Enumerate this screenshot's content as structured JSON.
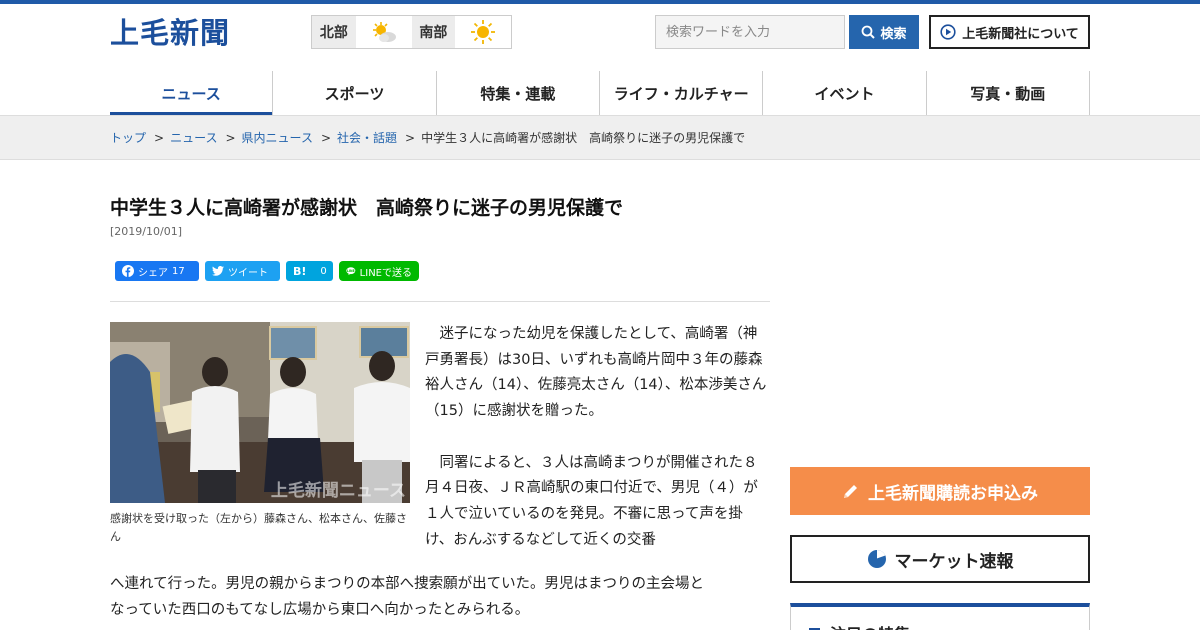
{
  "header": {
    "logo": "上毛新聞",
    "weather": [
      {
        "region": "北部",
        "icon": "partly-sunny-icon"
      },
      {
        "region": "南部",
        "icon": "sunny-icon"
      }
    ],
    "search": {
      "placeholder": "検索ワードを入力",
      "button_label": "検索"
    },
    "about_label": "上毛新聞社について"
  },
  "nav": {
    "items": [
      {
        "label": "ニュース",
        "active": true
      },
      {
        "label": "スポーツ"
      },
      {
        "label": "特集・連載"
      },
      {
        "label": "ライフ・カルチャー"
      },
      {
        "label": "イベント"
      },
      {
        "label": "写真・動画"
      }
    ]
  },
  "breadcrumb": {
    "items": [
      "トップ",
      "ニュース",
      "県内ニュース",
      "社会・話題"
    ],
    "current": "中学生３人に高崎署が感謝状　高崎祭りに迷子の男児保護で",
    "separator": ">"
  },
  "article": {
    "title": "中学生３人に高崎署が感謝状　高崎祭りに迷子の男児保護で",
    "date": "[2019/10/01]",
    "share": {
      "facebook_label": "シェア",
      "facebook_count": "17",
      "twitter_label": "ツイート",
      "hatena_label": "B!",
      "hatena_count": "0",
      "line_label": "LINEで送る"
    },
    "photo_watermark": "上毛新聞ニュース",
    "photo_caption": "感謝状を受け取った（左から）藤森さん、松本さん、佐藤さん",
    "paragraph1": "迷子になった幼児を保護したとして、高崎署（神戸勇署長）は30日、いずれも高崎片岡中３年の藤森裕人さん（14）、佐藤亮太さん（14）、松本渉美さん（15）に感謝状を贈った。",
    "paragraph2_a": "同署によると、３人は高崎まつりが開催された８月４日夜、ＪＲ高崎駅の東口付近で、男児（４）が１人で泣いているのを発見。不審に思って声を掛け、おんぶするなどして近くの交番",
    "paragraph2_lines": [
      "へ連れて行った。男児の親からまつりの本部へ捜索願が出ていた。男児はまつりの主会場と",
      "なっていた西口のもてなし広場から東口へ向かったとみられる。"
    ]
  },
  "sidebar": {
    "subscribe_label": "上毛新聞購読お申込み",
    "market_label": "マーケット速報",
    "featured_title": "注目の特集"
  },
  "colors": {
    "brand": "#1c4f9c",
    "accent_orange": "#f58d4a",
    "search_blue": "#2565ad"
  }
}
